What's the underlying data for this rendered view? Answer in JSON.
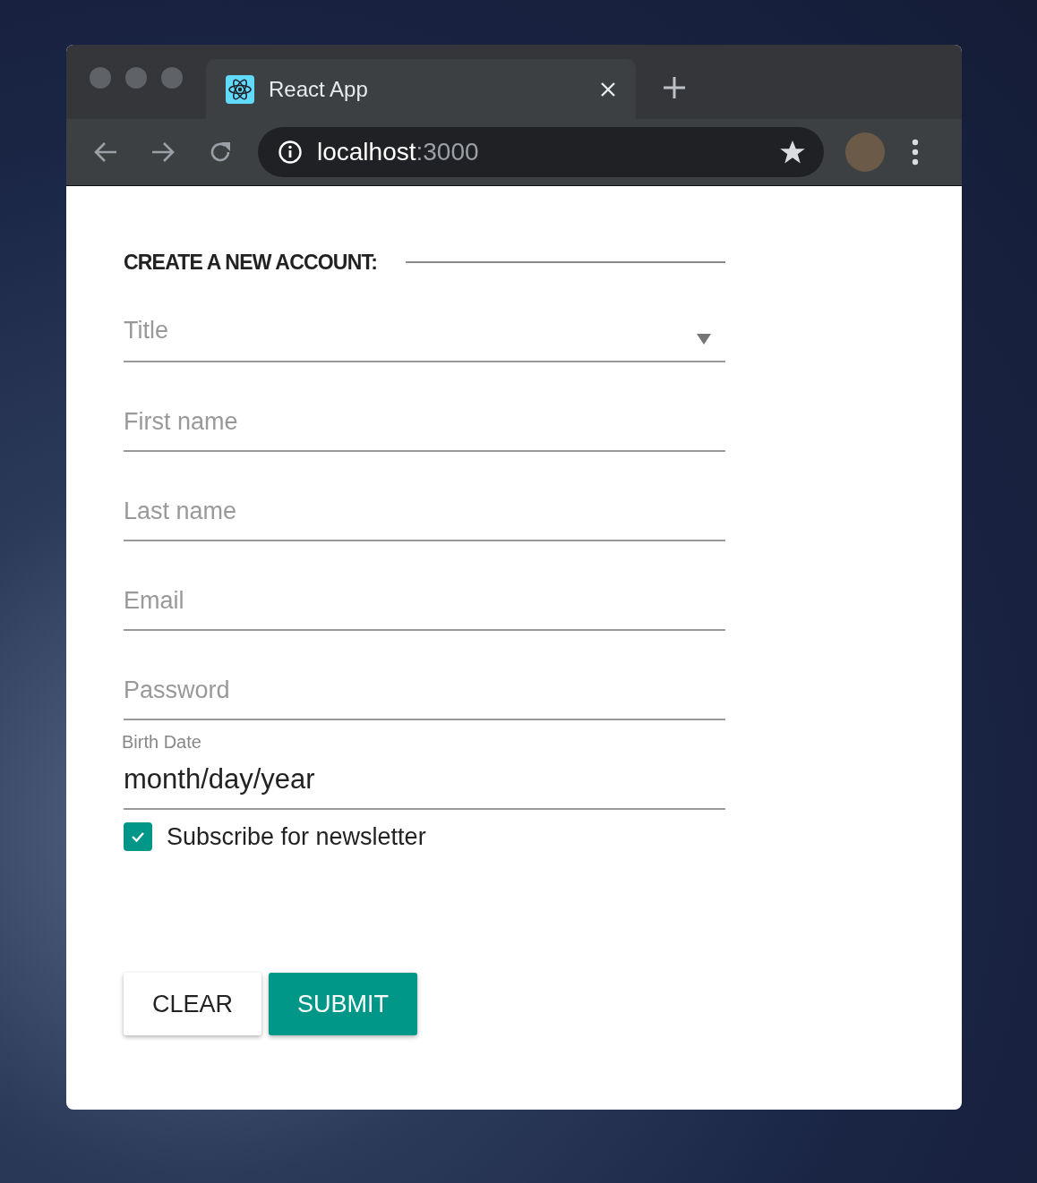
{
  "browser": {
    "tab": {
      "title": "React App"
    },
    "address": {
      "host": "localhost",
      "port": ":3000"
    }
  },
  "form": {
    "heading": "CREATE A NEW ACCOUNT:",
    "fields": [
      {
        "kind": "select",
        "placeholder": "Title"
      },
      {
        "kind": "text",
        "placeholder": "First name"
      },
      {
        "kind": "text",
        "placeholder": "Last name"
      },
      {
        "kind": "text",
        "placeholder": "Email"
      },
      {
        "kind": "text",
        "placeholder": "Password"
      },
      {
        "kind": "date",
        "label": "Birth Date",
        "value": "month/day/year"
      }
    ],
    "newsletter": {
      "label": "Subscribe for newsletter",
      "checked": true
    },
    "buttons": [
      {
        "label": "CLEAR",
        "kind": "secondary"
      },
      {
        "label": "SUBMIT",
        "kind": "primary"
      }
    ]
  }
}
